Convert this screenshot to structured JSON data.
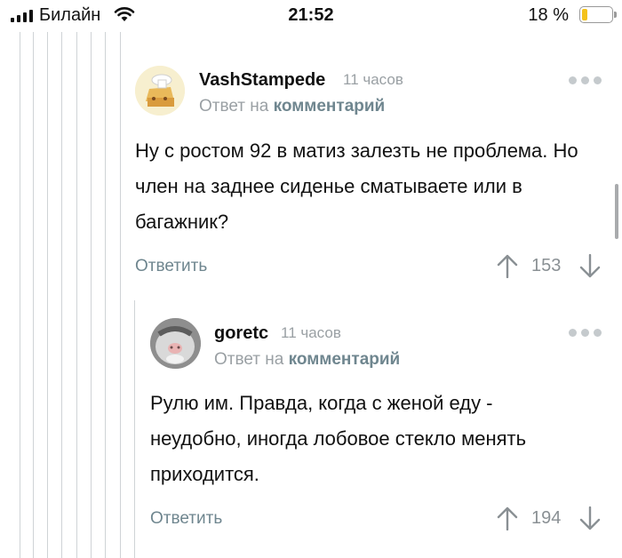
{
  "status_bar": {
    "carrier": "Билайн",
    "time": "21:52",
    "battery_percent_text": "18 %",
    "battery_level": 0.18,
    "battery_color": "#f4c21b"
  },
  "comments": [
    {
      "author": "VashStampede",
      "time": "11 часов",
      "reply_prefix": "Ответ на",
      "reply_link": "комментарий",
      "text": "Ну с ростом 92 в матиз залезть не проблема. Но член на заднее сиденье сматываете или в багажник?",
      "reply_label": "Ответить",
      "score": "153"
    },
    {
      "author": "goretc",
      "time": "11 часов",
      "reply_prefix": "Ответ на",
      "reply_link": "комментарий",
      "text": "Рулю им. Правда, когда с женой еду - неудобно, иногда лобовое стекло менять приходится.",
      "reply_label": "Ответить",
      "score": "194"
    }
  ],
  "colors": {
    "accent_link": "#6f868f",
    "muted": "#9aa0a4",
    "thread_line": "#cfd3d6"
  }
}
